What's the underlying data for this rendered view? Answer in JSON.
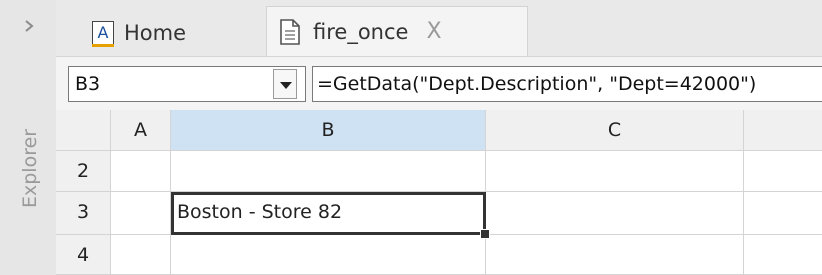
{
  "sidebar": {
    "label": "Explorer"
  },
  "tabs": [
    {
      "label": "Home",
      "icon": "text-a-icon"
    },
    {
      "label": "fire_once",
      "icon": "document-icon",
      "close": "X"
    }
  ],
  "formula_bar": {
    "name_box": "B3",
    "formula": "=GetData(\"Dept.Description\", \"Dept=42000\")"
  },
  "sheet": {
    "columns": [
      "A",
      "B",
      "C"
    ],
    "rows": [
      "2",
      "3",
      "4"
    ],
    "selected_cell": "B3",
    "cells": {
      "B3": "Boston - Store 82"
    }
  },
  "colors": {
    "accent": "#cfe2f3",
    "icon_blue": "#1b4f9c",
    "icon_orange": "#e6a100"
  }
}
